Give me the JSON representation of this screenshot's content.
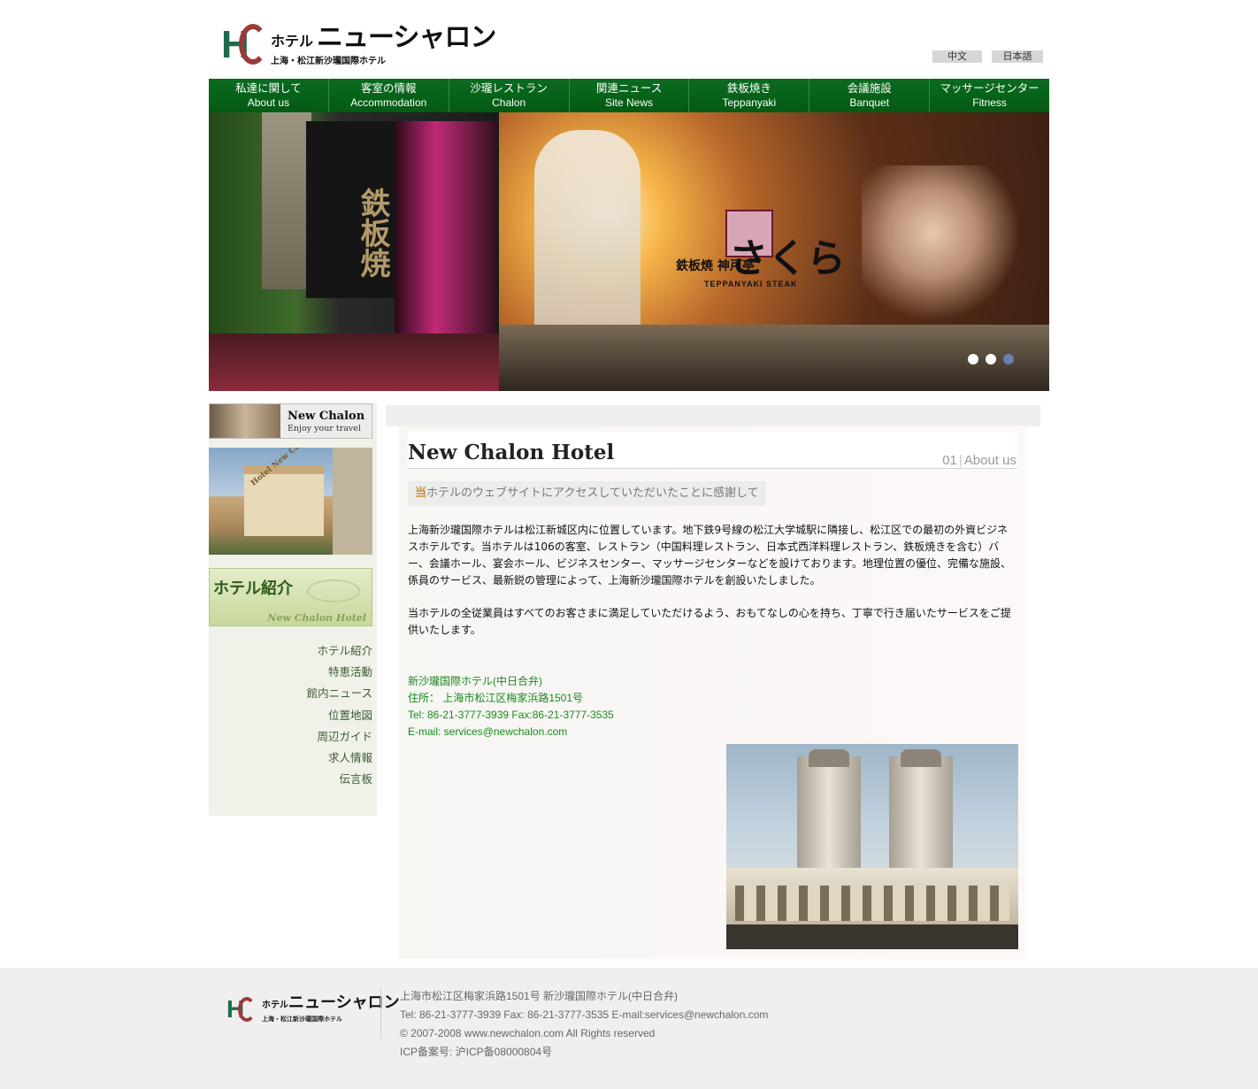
{
  "header": {
    "logo_kana": "ホテル",
    "logo_name": "ニューシャロン",
    "logo_sub": "上海・松江新沙瓏国際ホテル",
    "lang_zh": "中文",
    "lang_ja": "日本語"
  },
  "nav": [
    {
      "jp": "私達に関して",
      "en": "About us"
    },
    {
      "jp": "客室の情報",
      "en": "Accommodation"
    },
    {
      "jp": "沙瓏レストラン",
      "en": "Chalon"
    },
    {
      "jp": "関連ニュース",
      "en": "Site News"
    },
    {
      "jp": "鉄板焼き",
      "en": "Teppanyaki"
    },
    {
      "jp": "会議施設",
      "en": "Banquet"
    },
    {
      "jp": "マッサージセンター",
      "en": "Fitness"
    }
  ],
  "banner": {
    "noren_text": "鉄板焼",
    "brand_sub": "鉄板焼 神戸亭",
    "brand_main": "さくら",
    "brand_en": "TEPPANYAKI STEAK",
    "slide_count": 3,
    "active_slide": 1
  },
  "sidebar": {
    "badge_title": "New Chalon",
    "badge_sub": "Enjoy your travel",
    "photo_sign": "Hotel New Chalon",
    "section_jp": "ホテル紹介",
    "section_en": "New Chalon Hotel",
    "menu": [
      "ホテル紹介",
      "特恵活動",
      "館内ニュース",
      "位置地図",
      "周辺ガイド",
      "求人情報",
      "伝言板"
    ]
  },
  "content": {
    "title": "New Chalon Hotel",
    "section_num": "01",
    "section_label": "About us",
    "welcome_first": "当",
    "welcome_rest": "ホテルのウェブサイトにアクセスしていただいたことに感謝して",
    "para1": "上海新沙瓏国際ホテルは松江新城区内に位置しています。地下鉄9号線の松江大学城駅に隣接し、松江区での最初の外資ビジネスホテルです。当ホテルは106の客室、レストラン（中国料理レストラン、日本式西洋料理レストラン、鉄板焼きを含む）バー、会議ホール、宴会ホール、ビジネスセンター、マッサージセンターなどを設けております。地理位置の優位、完備な施設、係員のサービス、最新鋭の管理によって、上海新沙瓏国際ホテルを創設いたしました。",
    "para2": "当ホテルの全従業員はすべてのお客さまに満足していただけるよう、おもてなしの心を持ち、丁寧で行き届いたサービスをご提供いたします。",
    "contact": [
      "新沙瓏国際ホテル(中日合弁)",
      "住所：  上海市松江区梅家浜路1501号",
      "Tel: 86-21-3777-3939  Fax:86-21-3777-3535",
      "E-mail: services@newchalon.com"
    ]
  },
  "footer": {
    "logo_kana": "ホテル",
    "logo_name": "ニューシャロン",
    "logo_sub": "上海・松江新沙瓏国際ホテル",
    "lines": [
      "上海市松江区梅家浜路1501号 新沙瓏国際ホテル(中日合弁)",
      "Tel: 86-21-3777-3939 Fax: 86-21-3777-3535 E-mail:services@newchalon.com",
      "© 2007-2008 www.newchalon.com All Rights reserved",
      "ICP备案号: 沪ICP备08000804号"
    ]
  },
  "colors": {
    "nav_green": "#045a13",
    "contact_green": "#1a8a1a",
    "logo_green": "#1e6b4a",
    "logo_red": "#9b3a3a"
  }
}
